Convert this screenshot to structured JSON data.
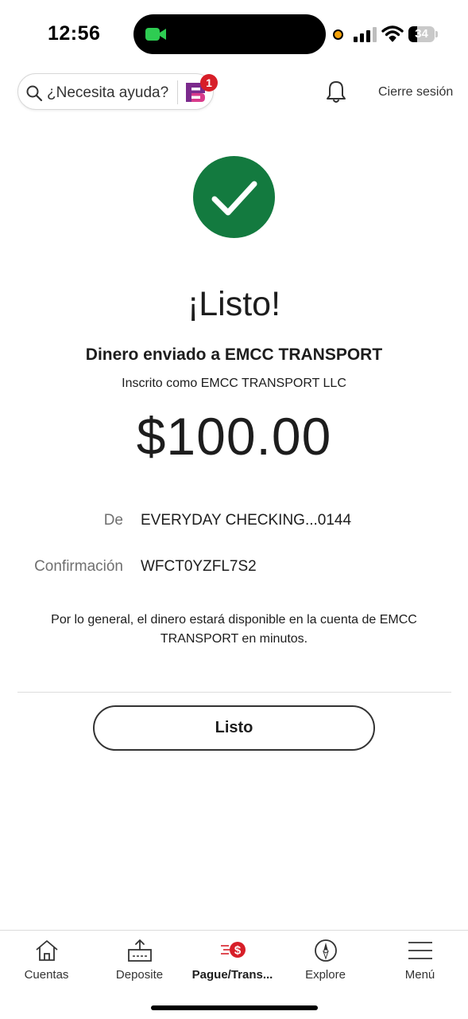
{
  "status_bar": {
    "time": "12:56",
    "battery_level": "34",
    "battery_fraction": 0.34
  },
  "header": {
    "help_placeholder": "¿Necesita ayuda?",
    "notification_count": "1",
    "logout_label": "Cierre sesión"
  },
  "confirmation": {
    "title": "¡Listo!",
    "sent_to": "Dinero enviado a EMCC TRANSPORT",
    "enrolled_as": "Inscrito como EMCC TRANSPORT LLC",
    "amount": "$100.00",
    "from_label": "De",
    "from_value": "EVERYDAY CHECKING...0144",
    "conf_label": "Confirmación",
    "conf_value": "WFCT0YZFL7S2",
    "note": "Por lo general, el dinero estará disponible en la cuenta de EMCC TRANSPORT en minutos.",
    "done_label": "Listo"
  },
  "bottom_nav": {
    "items": [
      {
        "label": "Cuentas",
        "icon": "home-icon"
      },
      {
        "label": "Deposite",
        "icon": "deposit-icon"
      },
      {
        "label": "Pague/Trans...",
        "icon": "pay-transfer-icon",
        "active": true
      },
      {
        "label": "Explore",
        "icon": "compass-icon"
      },
      {
        "label": "Menú",
        "icon": "menu-icon"
      }
    ]
  },
  "colors": {
    "success_green": "#137a3f",
    "badge_red": "#d71e28",
    "brand_purple": "#7b2a8c"
  }
}
